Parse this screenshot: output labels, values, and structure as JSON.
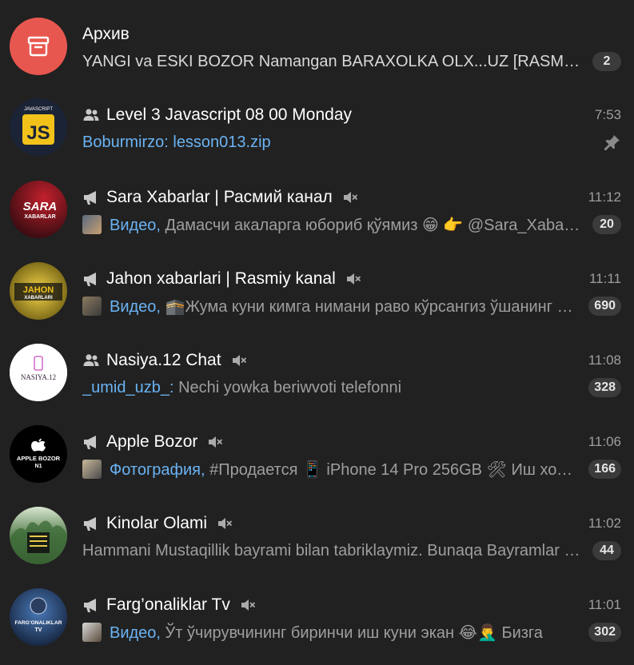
{
  "archive": {
    "title": "Архив",
    "preview": "YANGI va ESKI BOZOR Namangan BARAXOLKA OLX...UZ [RASMIY],...",
    "badge": "2"
  },
  "chats": [
    {
      "name": "Level 3 Javascript 08 00 Monday",
      "type": "group",
      "time": "7:53",
      "sender": "Boburmirzo: lesson013.zip",
      "pinned": true,
      "avatar_text": "JS",
      "avatar_caption": "JAVASCRIPT"
    },
    {
      "name": "Sara Xabarlar | Расмий канал",
      "type": "channel",
      "muted": true,
      "time": "11:12",
      "media": "Видео,",
      "preview": " Дамасчи акаларга юбориб қўямиз 😁  👉 @Sara_Xabarlar",
      "badge": "20",
      "avatar_text": "SARA",
      "avatar_caption": "XABARLAR"
    },
    {
      "name": "Jahon xabarlari | Rasmiy kanal",
      "type": "channel",
      "muted": true,
      "time": "11:11",
      "media": "Видео,",
      "preview": " 🕋Жума куни кимга нимани раво кўрсангиз ўшанинг ўзи",
      "badge": "690",
      "avatar_text": "JAHON",
      "avatar_caption": "XABARLARI"
    },
    {
      "name": "Nasiya.12 Chat",
      "type": "group",
      "muted": true,
      "time": "11:08",
      "sender": "_umid_uzb_:",
      "preview": " Nechi yowka beriwvoti telefonni",
      "badge": "328",
      "avatar_text": "NASIYA.12"
    },
    {
      "name": "Apple Bozor",
      "type": "channel",
      "muted": true,
      "time": "11:06",
      "media": "Фотография,",
      "preview": "    #Продается  📱 iPhone 14 Pro 256GB  🛠 Иш холати",
      "badge": "166",
      "avatar_text": "APPLE BOZOR",
      "avatar_caption": "N1"
    },
    {
      "name": "Kinolar Olami",
      "type": "channel",
      "muted": true,
      "time": "11:02",
      "preview": "Hammani Mustaqillik bayrami bilan tabriklaymiz. Bunaqa Bayramlar ko'p bo'lsin",
      "badge": "44"
    },
    {
      "name": "Farg’onaliklar Tv",
      "type": "channel",
      "muted": true,
      "time": "11:01",
      "media": "Видео,",
      "preview": " Ўт ўчирувчининг биринчи иш куни экан 😂🤦‍♂️  Бизга",
      "badge": "302",
      "avatar_text": "FARG’ONALIKLAR",
      "avatar_caption": "TV"
    }
  ],
  "colors": {
    "background": "#212121",
    "accent": "#6ab3f3",
    "archive": "#e8574f",
    "muted_text": "#9e9e9e",
    "badge": "#3b3b3b"
  }
}
